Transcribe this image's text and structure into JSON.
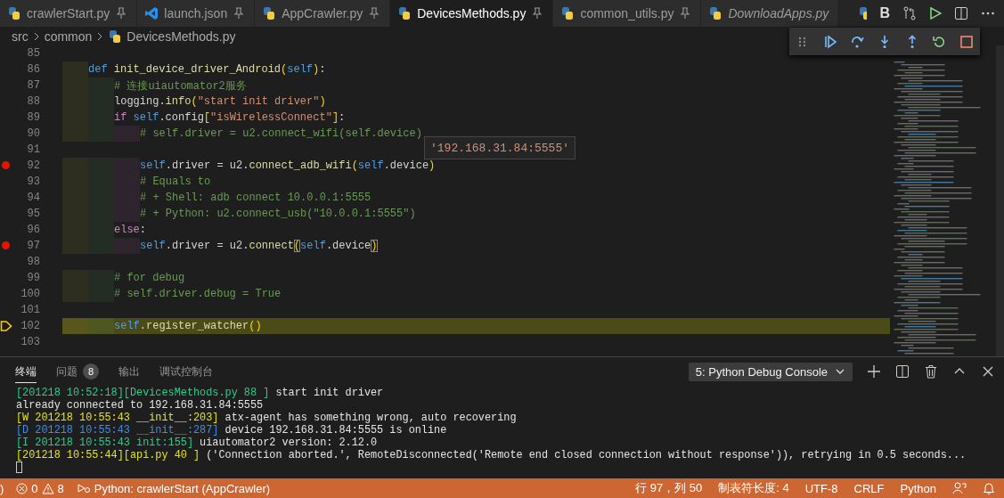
{
  "tabs": [
    {
      "label": "crawlerStart.py",
      "kind": "python",
      "pinned": true,
      "selected": false,
      "preview": false
    },
    {
      "label": "launch.json",
      "kind": "config",
      "pinned": true,
      "selected": false,
      "preview": false
    },
    {
      "label": "AppCrawler.py",
      "kind": "python",
      "pinned": true,
      "selected": false,
      "preview": false
    },
    {
      "label": "DevicesMethods.py",
      "kind": "python",
      "pinned": true,
      "selected": true,
      "preview": false
    },
    {
      "label": "common_utils.py",
      "kind": "python",
      "pinned": true,
      "selected": false,
      "preview": false
    },
    {
      "label": "DownloadApps.py",
      "kind": "python",
      "pinned": false,
      "selected": false,
      "preview": true
    }
  ],
  "editor_actions": {
    "letter_button": "B"
  },
  "breadcrumb": [
    "src",
    "common",
    "DevicesMethods.py"
  ],
  "code_lines": [
    {
      "number": "85",
      "breakpoint": false,
      "current": false
    },
    {
      "number": "86",
      "breakpoint": false,
      "current": false,
      "tokens": [
        {
          "kind": "kw",
          "text": "def "
        },
        {
          "kind": "fn",
          "text": "init_device_driver_Android"
        },
        {
          "kind": "br",
          "text": "("
        },
        {
          "kind": "self",
          "text": "self"
        },
        {
          "kind": "br",
          "text": ")"
        },
        {
          "kind": "p",
          "text": ":"
        }
      ],
      "children": [
        {
          "number": "87",
          "breakpoint": false,
          "current": false,
          "tokens": [
            {
              "kind": "cmt",
              "text": "# 连接uiautomator2服务"
            }
          ]
        },
        {
          "number": "88",
          "breakpoint": false,
          "current": false,
          "tokens": [
            {
              "kind": "p",
              "text": "logging."
            },
            {
              "kind": "fn",
              "text": "info"
            },
            {
              "kind": "br",
              "text": "("
            },
            {
              "kind": "str",
              "text": "\"start init driver\""
            },
            {
              "kind": "br",
              "text": ")"
            }
          ]
        },
        {
          "number": "89",
          "breakpoint": false,
          "current": false,
          "tokens": [
            {
              "kind": "ctl",
              "text": "if "
            },
            {
              "kind": "self",
              "text": "self"
            },
            {
              "kind": "p",
              "text": ".config"
            },
            {
              "kind": "br",
              "text": "["
            },
            {
              "kind": "str",
              "text": "\"isWirelessConnect\""
            },
            {
              "kind": "br",
              "text": "]"
            },
            {
              "kind": "p",
              "text": ":"
            }
          ],
          "children": [
            {
              "number": "90",
              "breakpoint": false,
              "current": false,
              "tokens": [
                {
                  "kind": "cmt",
                  "text": "# self.driver = u2.connect_wifi(self.device)"
                }
              ]
            },
            {
              "number": "91",
              "breakpoint": false,
              "current": false
            },
            {
              "number": "92",
              "breakpoint": true,
              "current": false,
              "tokens": [
                {
                  "kind": "self",
                  "text": "self"
                },
                {
                  "kind": "p",
                  "text": ".driver = u2."
                },
                {
                  "kind": "fn",
                  "text": "connect_adb_wifi"
                },
                {
                  "kind": "br",
                  "text": "("
                },
                {
                  "kind": "self",
                  "text": "self"
                },
                {
                  "kind": "p",
                  "text": ".device"
                },
                {
                  "kind": "br",
                  "text": ")"
                }
              ]
            },
            {
              "number": "93",
              "breakpoint": false,
              "current": false,
              "tokens": [
                {
                  "kind": "cmt",
                  "text": "# Equals to"
                }
              ]
            },
            {
              "number": "94",
              "breakpoint": false,
              "current": false,
              "tokens": [
                {
                  "kind": "cmt",
                  "text": "# + Shell: adb connect 10.0.0.1:5555"
                }
              ]
            },
            {
              "number": "95",
              "breakpoint": false,
              "current": false,
              "tokens": [
                {
                  "kind": "cmt",
                  "text": "# + Python: u2.connect_usb(\"10.0.0.1:5555\")"
                }
              ]
            }
          ]
        },
        {
          "number": "96",
          "breakpoint": false,
          "current": false,
          "tokens": [
            {
              "kind": "ctl",
              "text": "else"
            },
            {
              "kind": "p",
              "text": ":"
            }
          ],
          "children": [
            {
              "number": "97",
              "breakpoint": true,
              "current": false,
              "tokens": [
                {
                  "kind": "self",
                  "text": "self"
                },
                {
                  "kind": "p",
                  "text": ".driver = u2."
                },
                {
                  "kind": "fn",
                  "text": "connect"
                },
                {
                  "kind": "brm",
                  "text": "("
                },
                {
                  "kind": "self",
                  "text": "self"
                },
                {
                  "kind": "p",
                  "text": ".device"
                },
                {
                  "kind": "brm",
                  "text": ")"
                }
              ]
            }
          ]
        },
        {
          "number": "98",
          "breakpoint": false,
          "current": false
        },
        {
          "number": "99",
          "breakpoint": false,
          "current": false,
          "tokens": [
            {
              "kind": "cmt",
              "text": "# for debug"
            }
          ]
        },
        {
          "number": "100",
          "breakpoint": false,
          "current": false,
          "tokens": [
            {
              "kind": "cmt",
              "text": "# self.driver.debug = True"
            }
          ]
        },
        {
          "number": "101",
          "breakpoint": false,
          "current": false
        },
        {
          "number": "102",
          "breakpoint": false,
          "current": true,
          "tokens": [
            {
              "kind": "self",
              "text": "self"
            },
            {
              "kind": "p",
              "text": "."
            },
            {
              "kind": "fn",
              "text": "register_watcher"
            },
            {
              "kind": "br",
              "text": "()"
            }
          ]
        },
        {
          "number": "103",
          "breakpoint": false,
          "current": false
        }
      ]
    }
  ],
  "hover_tooltip": "'192.168.31.84:5555'",
  "panel": {
    "tabs": [
      {
        "label": "终端",
        "selected": true
      },
      {
        "label": "问题",
        "selected": false,
        "badge": "8"
      },
      {
        "label": "输出",
        "selected": false
      },
      {
        "label": "调试控制台",
        "selected": false
      }
    ],
    "terminal_select": "5: Python Debug Console",
    "terminal_lines": [
      [
        {
          "kind": "info",
          "text": "[201218 10:52:18][DevicesMethods.py 88 ]"
        },
        {
          "kind": "plain",
          "text": " start init driver"
        }
      ],
      [
        {
          "kind": "plain",
          "text": "already connected to 192.168.31.84:5555"
        }
      ],
      [
        {
          "kind": "warn",
          "text": "[W 201218 10:55:43 __init__:203]"
        },
        {
          "kind": "plain",
          "text": " atx-agent has something wrong, auto recovering"
        }
      ],
      [
        {
          "kind": "debug",
          "text": "[D 201218 10:55:43 __init__:287]"
        },
        {
          "kind": "plain",
          "text": " device 192.168.31.84:5555 is online"
        }
      ],
      [
        {
          "kind": "info",
          "text": "[I 201218 10:55:43 init:155]"
        },
        {
          "kind": "plain",
          "text": " uiautomator2 version: 2.12.0"
        }
      ],
      [
        {
          "kind": "warn",
          "text": "[201218 10:55:44][api.py 40 ]"
        },
        {
          "kind": "plain",
          "text": " ('Connection aborted.', RemoteDisconnected('Remote end closed connection without response')), retrying in 0.5 seconds..."
        }
      ]
    ]
  },
  "status_bar": {
    "remote": ")",
    "errors": "0",
    "warnings": "8",
    "debug_target": "Python: crawlerStart (AppCrawler)",
    "right": [
      "行 97，列 50",
      "制表符长度: 4",
      "UTF-8",
      "CRLF",
      "Python"
    ]
  }
}
